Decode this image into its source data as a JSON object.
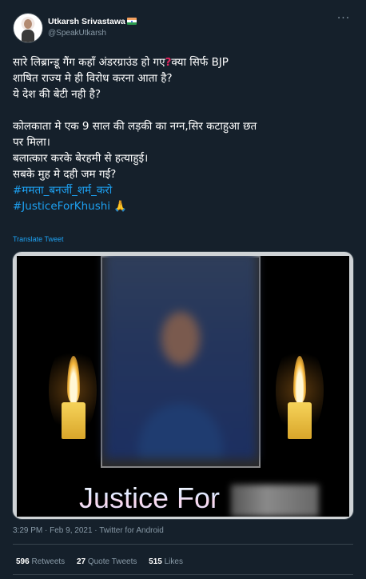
{
  "author": {
    "display_name": "Utkarsh Srivastawa",
    "handle": "@SpeakUtkarsh"
  },
  "tweet": {
    "line1_a": "सारे लिब्रान्डू गैंग कहाँ अंडरग्राउंड हो गए",
    "line1_b": "क्या सिर्फ BJP",
    "line2": "शाषित राज्य मे ही विरोध करना आता है?",
    "line3": "ये देश की बेटी नही है?",
    "line4": "कोलकाता मे एक 9 साल की लड़की का नग्न,सिर कटाहुआ छत",
    "line5": "पर मिला।",
    "line6": "बलात्कार करके बेरहमी से हत्याहुई।",
    "line7": "सबके मुह मे दही जम गई?",
    "hashtag1": "#ममता_बनर्जी_शर्म_करो",
    "hashtag2": "#JusticeForKhushi",
    "emoji": "🙏",
    "translate_label": "Translate Tweet"
  },
  "media": {
    "caption": "Justice For"
  },
  "meta": {
    "timestamp": "3:29 PM · Feb 9, 2021 · Twitter for Android"
  },
  "stats": {
    "retweets_count": "596",
    "retweets_label": "Retweets",
    "quote_count": "27",
    "quote_label": "Quote Tweets",
    "likes_count": "515",
    "likes_label": "Likes"
  }
}
